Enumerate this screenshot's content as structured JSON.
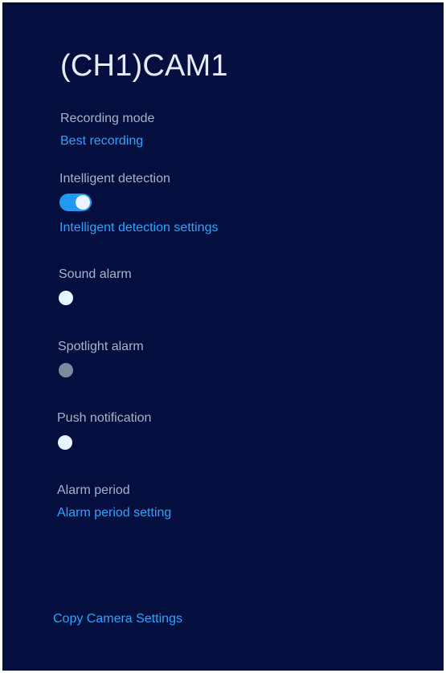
{
  "page": {
    "title": "(CH1)CAM1"
  },
  "recording": {
    "label": "Recording mode",
    "value": "Best recording"
  },
  "intelligent_detection": {
    "label": "Intelligent detection",
    "enabled": true,
    "settings_link": "Intelligent detection settings"
  },
  "sound_alarm": {
    "label": "Sound alarm",
    "enabled": false
  },
  "spotlight_alarm": {
    "label": "Spotlight alarm",
    "enabled": false,
    "disabled": true
  },
  "push_notification": {
    "label": "Push notification",
    "enabled": false
  },
  "alarm_period": {
    "label": "Alarm period",
    "link": "Alarm period setting"
  },
  "footer": {
    "copy_settings": "Copy Camera Settings"
  },
  "colors": {
    "background": "#050f3f",
    "accent": "#2aa4ff",
    "toggle_on": "#1e9bf0",
    "label": "#a9b1c8"
  }
}
